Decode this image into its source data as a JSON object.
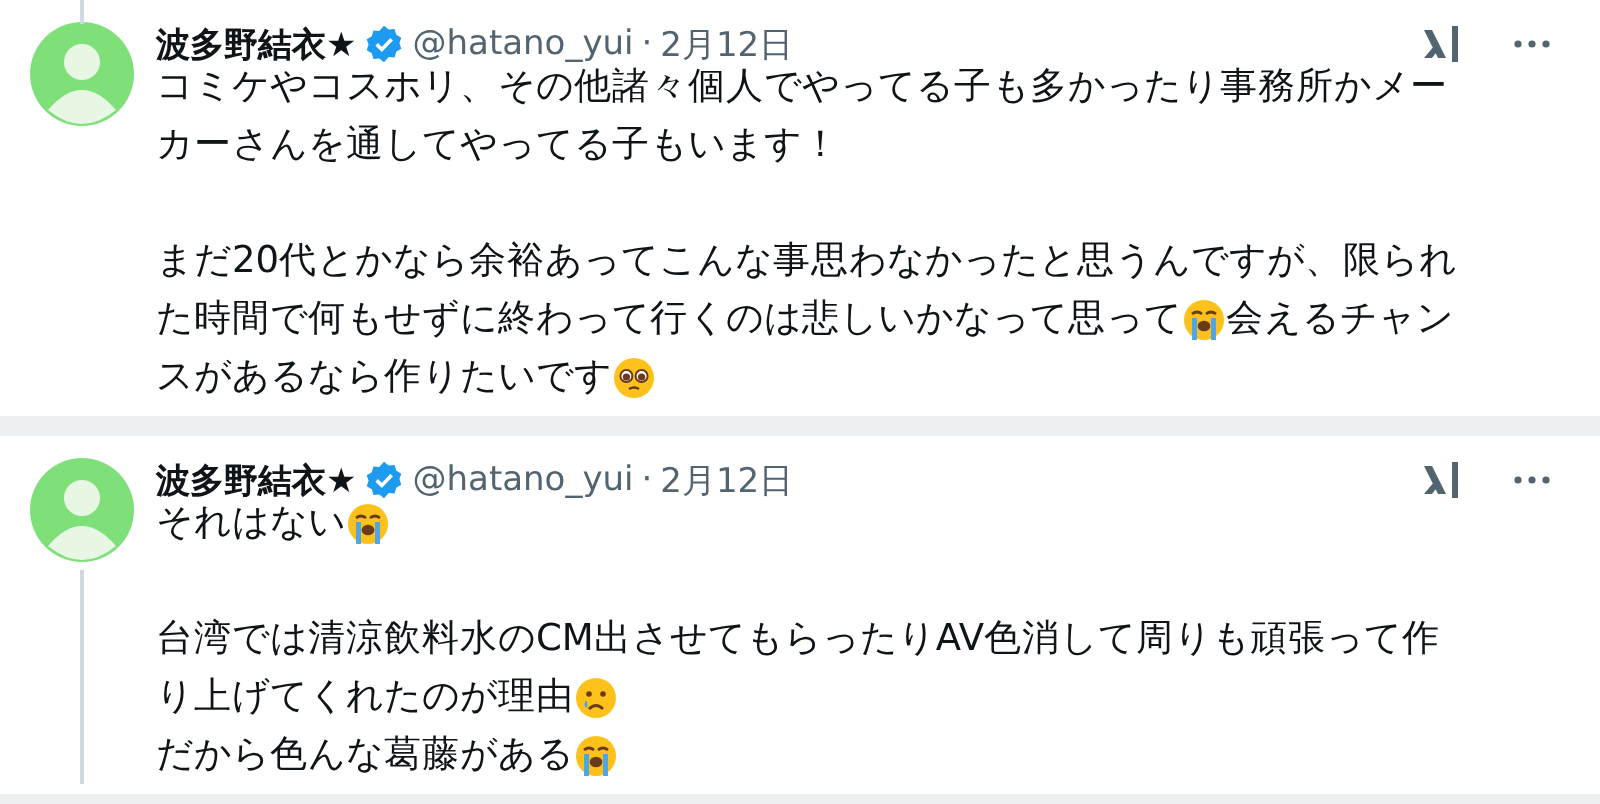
{
  "tweets": [
    {
      "author": {
        "name": "波多野結衣★",
        "handle": "@hatano_yui",
        "verified": true
      },
      "separator": "·",
      "date": "2月12日",
      "thread_above": true,
      "thread_below": false,
      "paragraphs": [
        {
          "lines": [
            [
              {
                "kind": "text",
                "text": "コミケやコスホリ、その他諸々個人でやってる子も多かったり事務所かメー"
              }
            ],
            [
              {
                "kind": "text",
                "text": "カーさんを通してやってる子もいます！"
              }
            ]
          ]
        },
        {
          "lines": [
            [
              {
                "kind": "text",
                "text": "まだ20代とかなら余裕あってこんな事思わなかったと思うんですが、限られ"
              }
            ],
            [
              {
                "kind": "text",
                "text": "た時間で何もせずに終わって行くのは悲しいかなって思って"
              },
              {
                "kind": "sobbing"
              },
              {
                "kind": "text",
                "text": "会えるチャン"
              }
            ],
            [
              {
                "kind": "text",
                "text": "スがあるなら作りたいです"
              },
              {
                "kind": "pleading"
              }
            ]
          ]
        }
      ]
    },
    {
      "author": {
        "name": "波多野結衣★",
        "handle": "@hatano_yui",
        "verified": true
      },
      "separator": "·",
      "date": "2月12日",
      "thread_above": false,
      "thread_below": true,
      "paragraphs": [
        {
          "lines": [
            [
              {
                "kind": "text",
                "text": "それはない"
              },
              {
                "kind": "sobbing"
              }
            ]
          ]
        },
        {
          "lines": [
            [
              {
                "kind": "text",
                "text": "台湾では清涼飲料水のCM出させてもらったりAV色消して周りも頑張って作"
              }
            ],
            [
              {
                "kind": "text",
                "text": "り上げてくれたのが理由"
              },
              {
                "kind": "teary"
              }
            ],
            [
              {
                "kind": "text",
                "text": "だから色んな葛藤がある"
              },
              {
                "kind": "sobbing"
              }
            ]
          ]
        }
      ]
    }
  ]
}
